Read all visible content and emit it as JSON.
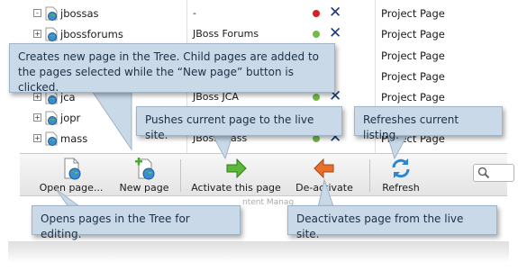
{
  "tree_rows": [
    {
      "name": "jbossas",
      "title": "-",
      "status": "#d92020",
      "type": "Project Page",
      "expander": "-"
    },
    {
      "name": "jbossforums",
      "title": "JBoss Forums",
      "status": "#74b94a",
      "type": "Project Page",
      "expander": "+"
    },
    {
      "name": "",
      "title": "",
      "status": "",
      "type": "Project Page",
      "expander": ""
    },
    {
      "name": "",
      "title": "",
      "status": "",
      "type": "Project Page",
      "expander": ""
    },
    {
      "name": "jca",
      "title": "JBoss JCA",
      "status": "#74b94a",
      "type": "Project Page",
      "expander": "+"
    },
    {
      "name": "jopr",
      "title": "",
      "status": "",
      "type": "Project Page",
      "expander": "+"
    },
    {
      "name": "mass",
      "title": "JBoss Mass",
      "status": "#74b94a",
      "type": "Project Page",
      "expander": "+"
    }
  ],
  "toolbar": {
    "open_label": "Open page...",
    "new_label": "New page",
    "activate_label": "Activate this page",
    "deactivate_label": "De-activate",
    "refresh_label": "Refresh"
  },
  "footer_fragment": "ntent Manag",
  "callouts": {
    "new_page": "Creates new page in the Tree. Child pages are added to the pages selected while the “New page” button is clicked.",
    "activate": "Pushes current page to the live site.",
    "refresh": "Refreshes current listing.",
    "open": "Opens pages in the Tree for editing.",
    "deactivate": "Deactivates page from the live site."
  },
  "icons": {
    "page": "page-globe-icon",
    "new_page": "new-page-icon",
    "activate": "green-arrow-icon",
    "deactivate": "orange-arrow-icon",
    "refresh": "refresh-icon",
    "search": "search-icon",
    "delete": "delete-x-icon"
  },
  "colors": {
    "callout_bg": "#c9d9e8",
    "active": "#74b94a",
    "inactive": "#d92020",
    "activate_arrow": "#5cb83a",
    "deactivate_arrow": "#e8702a"
  }
}
